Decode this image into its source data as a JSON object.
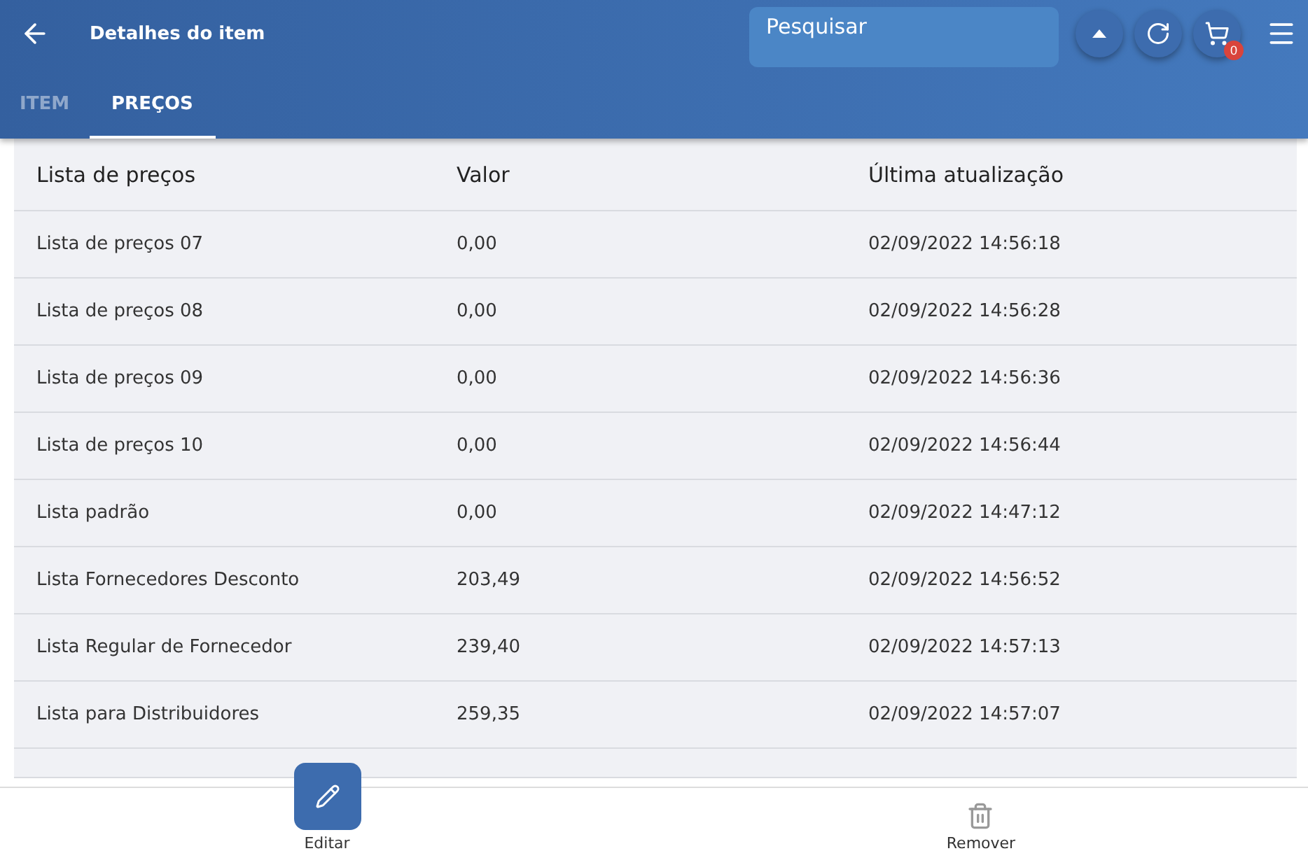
{
  "header": {
    "title": "Detalhes do item",
    "search": {
      "placeholder": "Pesquisar"
    },
    "cart_count": "0"
  },
  "tabs": [
    {
      "label": "ITEM",
      "selected": false
    },
    {
      "label": "PREÇOS",
      "selected": true
    }
  ],
  "table": {
    "columns": [
      "Lista de preços",
      "Valor",
      "Última atualização"
    ],
    "rows": [
      [
        "Lista de preços 07",
        "0,00",
        "02/09/2022 14:56:18"
      ],
      [
        "Lista de preços 08",
        "0,00",
        "02/09/2022 14:56:28"
      ],
      [
        "Lista de preços 09",
        "0,00",
        "02/09/2022 14:56:36"
      ],
      [
        "Lista de preços 10",
        "0,00",
        "02/09/2022 14:56:44"
      ],
      [
        "Lista padrão",
        "0,00",
        "02/09/2022 14:47:12"
      ],
      [
        "Lista Fornecedores Desconto",
        "203,49",
        "02/09/2022 14:56:52"
      ],
      [
        "Lista Regular de Fornecedor",
        "239,40",
        "02/09/2022 14:57:13"
      ],
      [
        "Lista para Distribuidores",
        "259,35",
        "02/09/2022 14:57:07"
      ]
    ]
  },
  "actions": [
    {
      "kind": "primary",
      "label": "Editar"
    },
    {
      "kind": "plain",
      "label": "Remover"
    }
  ]
}
